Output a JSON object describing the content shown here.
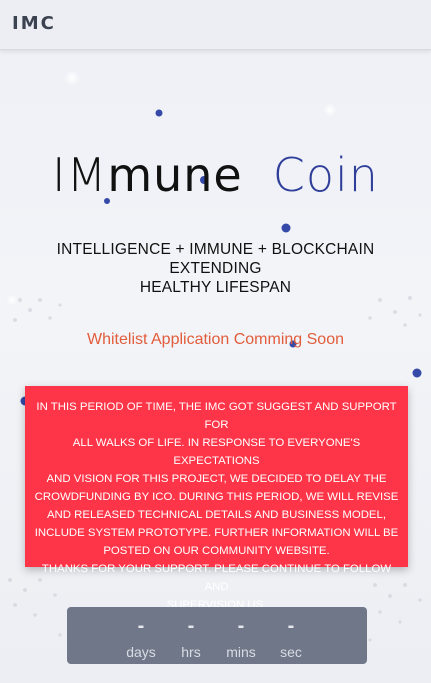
{
  "header": {
    "brand": "IMC"
  },
  "hero": {
    "logo_part1": "IM",
    "logo_part2": "mune",
    "logo_part3": "Coin",
    "tagline_line1": "INTELLIGENCE + IMMUNE + BLOCKCHAIN EXTENDING",
    "tagline_line2": "HEALTHY LIFESPAN"
  },
  "whitelist": {
    "text": "Whitelist Application Comming Soon"
  },
  "notice": {
    "line1": "IN THIS PERIOD OF TIME, THE IMC GOT SUGGEST AND SUPPORT FOR",
    "line2": "ALL WALKS OF LIFE. IN RESPONSE TO EVERYONE'S EXPECTATIONS",
    "line3": "AND VISION FOR THIS PROJECT, WE DECIDED TO DELAY THE",
    "line4": "CROWDFUNDING BY ICO. DURING THIS PERIOD, WE WILL REVISE",
    "line5": "AND RELEASED TECHNICAL DETAILS AND BUSINESS MODEL,",
    "line6": "INCLUDE SYSTEM PROTOTYPE. FURTHER INFORMATION WILL BE",
    "line7": "POSTED ON OUR COMMUNITY WEBSITE.",
    "line8": "THANKS FOR YOUR SUPPORT. PLEASE CONTINUE TO FOLLOW AND",
    "line9": "SUPERVISION US."
  },
  "countdown": {
    "days_value": "-",
    "days_label": "days",
    "hrs_value": "-",
    "hrs_label": "hrs",
    "mins_value": "-",
    "mins_label": "mins",
    "sec_value": "-",
    "sec_label": "sec"
  },
  "colors": {
    "accent_blue": "#2f3f9a",
    "notice_red": "#fe3548",
    "whitelist_orange": "#e25d3c",
    "countdown_bg": "#6f7788"
  }
}
